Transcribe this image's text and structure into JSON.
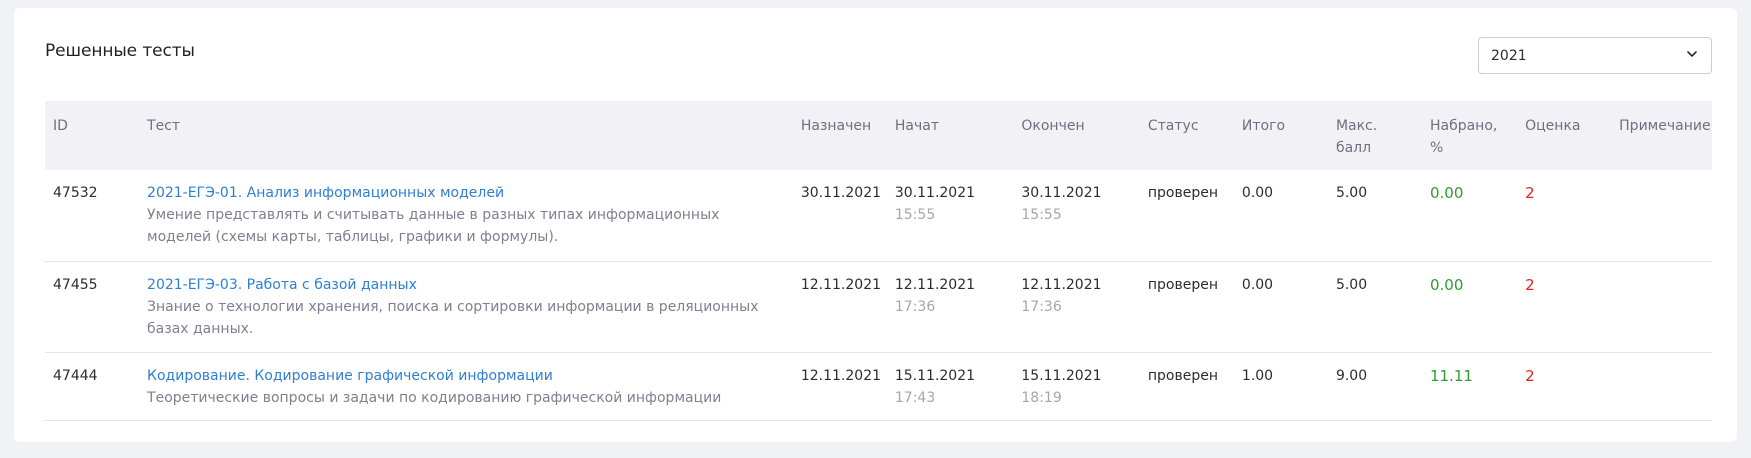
{
  "title": "Решенные тесты",
  "year_select": {
    "value": "2021"
  },
  "columns": {
    "id": "ID",
    "test": "Тест",
    "assigned": "Назначен",
    "started": "Начат",
    "finished": "Окончен",
    "status": "Статус",
    "total": "Итого",
    "max": "Макс. балл",
    "percent": "Набрано, %",
    "grade": "Оценка",
    "note": "Примечание"
  },
  "rows": [
    {
      "id": "47532",
      "test_title": "2021-ЕГЭ-01. Анализ информационных моделей",
      "test_desc": "Умение представлять и считывать данные в разных типах информационных моделей (схемы карты, таблицы, графики и формулы).",
      "assigned": "30.11.2021",
      "started_date": "30.11.2021",
      "started_time": "15:55",
      "finished_date": "30.11.2021",
      "finished_time": "15:55",
      "status": "проверен",
      "total": "0.00",
      "max": "5.00",
      "percent": "0.00",
      "grade": "2",
      "note": ""
    },
    {
      "id": "47455",
      "test_title": "2021-ЕГЭ-03. Работа с базой данных",
      "test_desc": "Знание о технологии хранения, поиска и сортировки информации в реляционных базах данных.",
      "assigned": "12.11.2021",
      "started_date": "12.11.2021",
      "started_time": "17:36",
      "finished_date": "12.11.2021",
      "finished_time": "17:36",
      "status": "проверен",
      "total": "0.00",
      "max": "5.00",
      "percent": "0.00",
      "grade": "2",
      "note": ""
    },
    {
      "id": "47444",
      "test_title": "Кодирование. Кодирование графической информации",
      "test_desc": "Теоретические вопросы и задачи по кодированию графической информации",
      "assigned": "12.11.2021",
      "started_date": "15.11.2021",
      "started_time": "17:43",
      "finished_date": "15.11.2021",
      "finished_time": "18:19",
      "status": "проверен",
      "total": "1.00",
      "max": "9.00",
      "percent": "11.11",
      "grade": "2",
      "note": ""
    }
  ],
  "colors": {
    "link": "#2f7fd3",
    "percent": "#2f9c2f",
    "grade": "#e32222",
    "muted": "#a3a6b0"
  },
  "icons": {
    "select_arrow": "chevron-down-icon"
  }
}
